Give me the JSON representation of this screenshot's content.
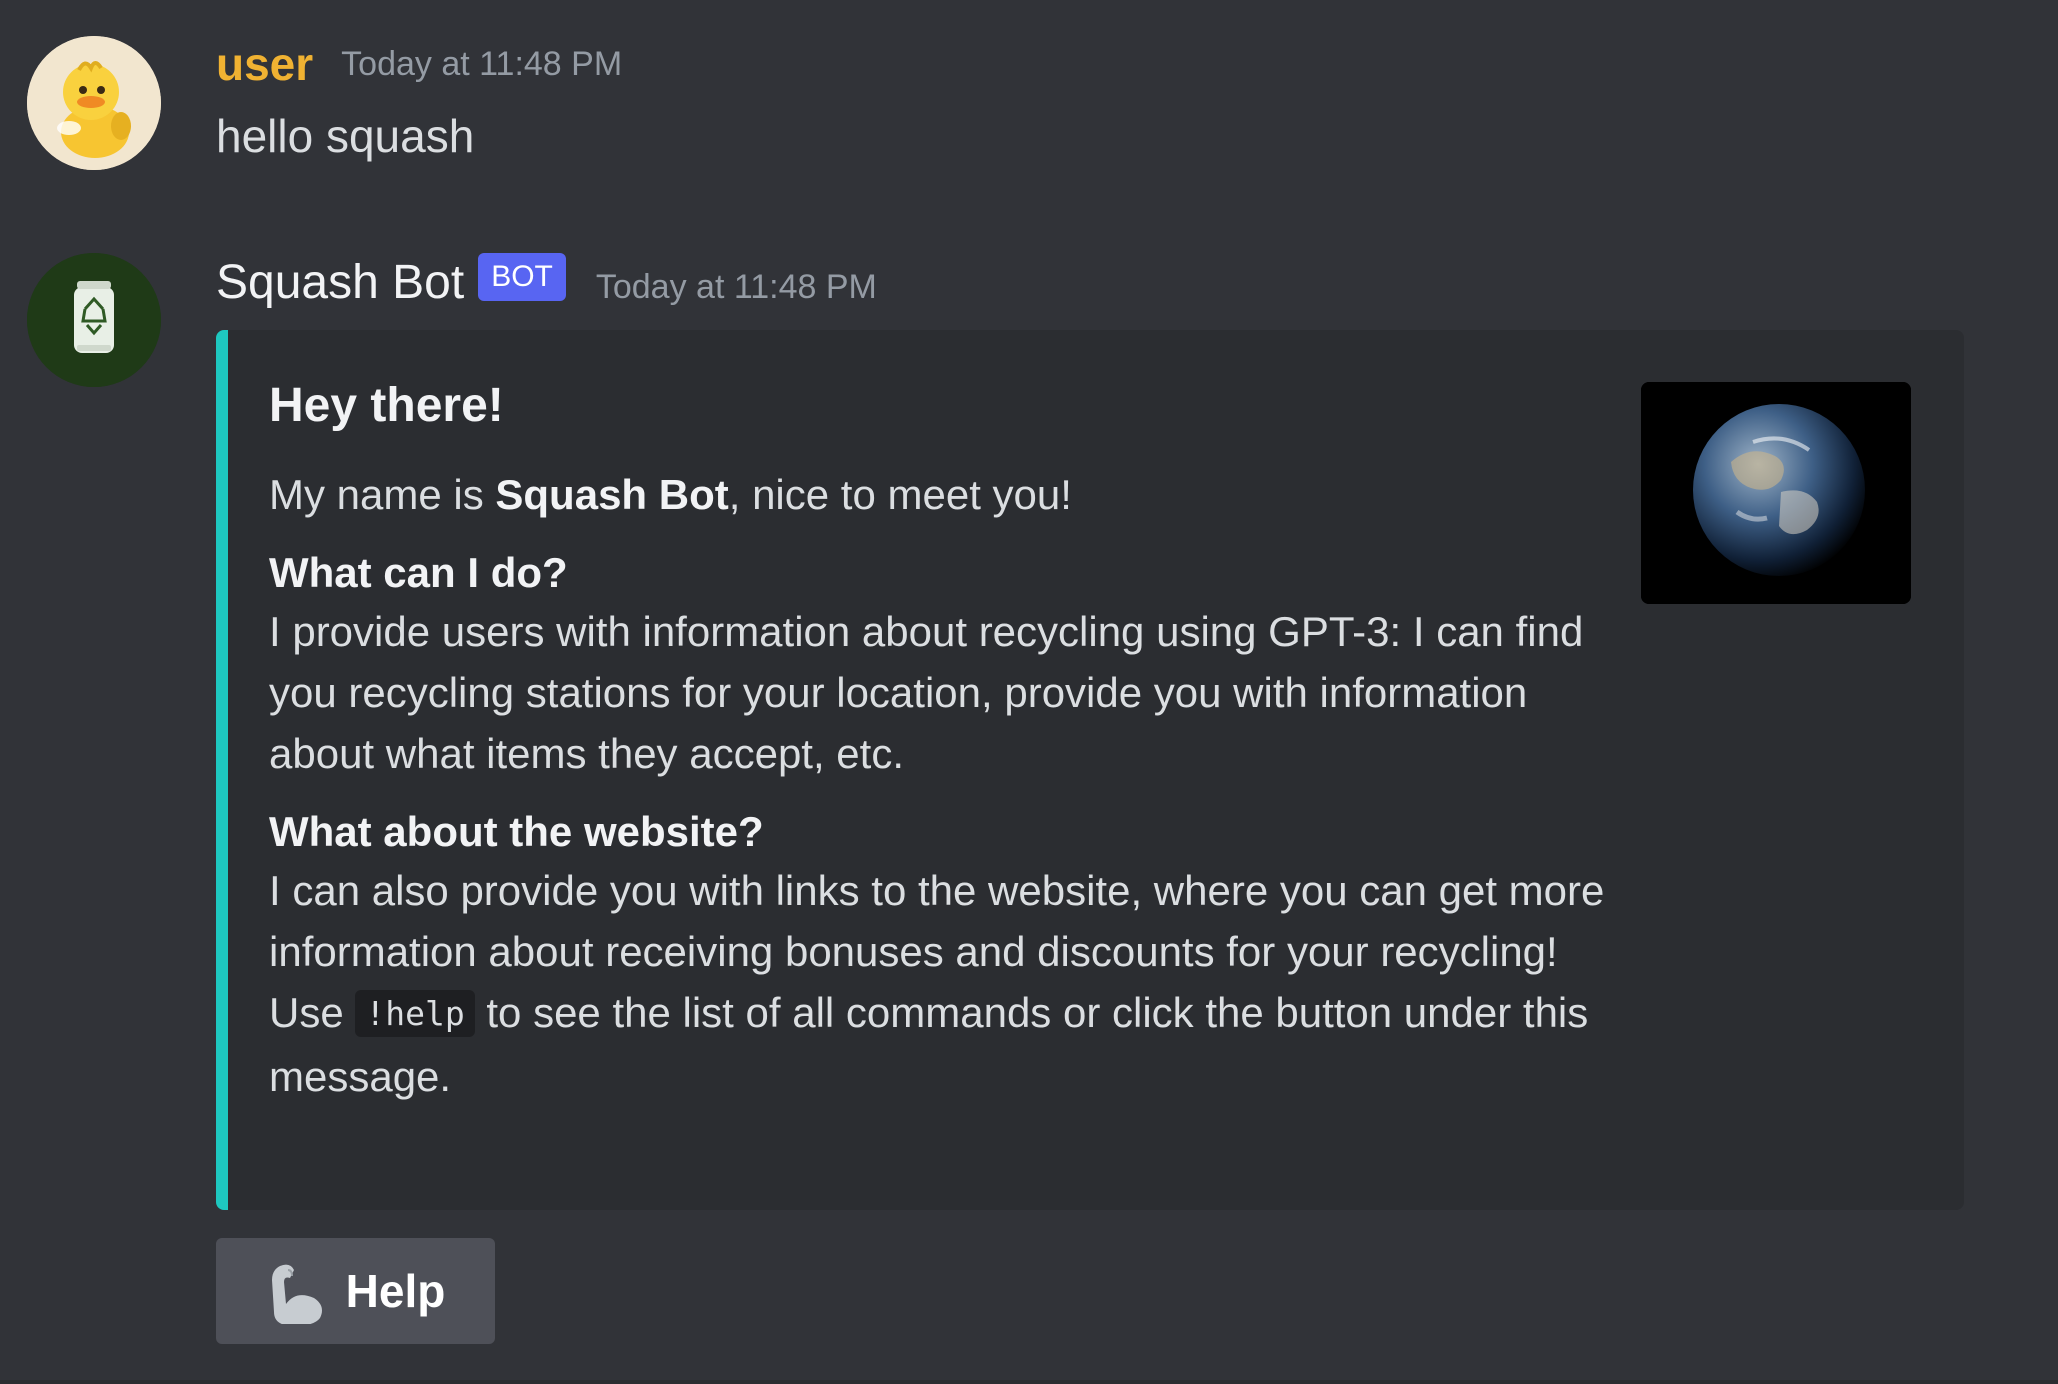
{
  "messages": [
    {
      "author": "user",
      "timestamp": "Today at 11:48 PM",
      "content": "hello squash",
      "avatar_icon": "duck-avatar-icon",
      "name_color": "#f0b232"
    },
    {
      "author": "Squash Bot",
      "tag": "BOT",
      "timestamp": "Today at 11:48 PM",
      "avatar_icon": "recycle-can-avatar-icon",
      "embed": {
        "accent_color": "#1ec8c0",
        "title": "Hey there!",
        "intro_prefix": "My name is ",
        "intro_bold": "Squash Bot",
        "intro_suffix": ", nice to meet you!",
        "section1_heading": "What can I do?",
        "section1_text": "I provide users with information about recycling using GPT-3: I can find you recycling stations for your location, provide you with information about what items they accept, etc.",
        "section2_heading": "What about the website?",
        "section2_text_before": "I can also provide you with links to the website, where you can get more information about receiving bonuses and discounts for your recycling! Use ",
        "section2_code": "!help",
        "section2_text_after": " to see the list of all commands or click the button under this message.",
        "thumbnail_icon": "earth-icon"
      },
      "button": {
        "label": "Help",
        "icon": "flexed-biceps-icon"
      }
    }
  ]
}
